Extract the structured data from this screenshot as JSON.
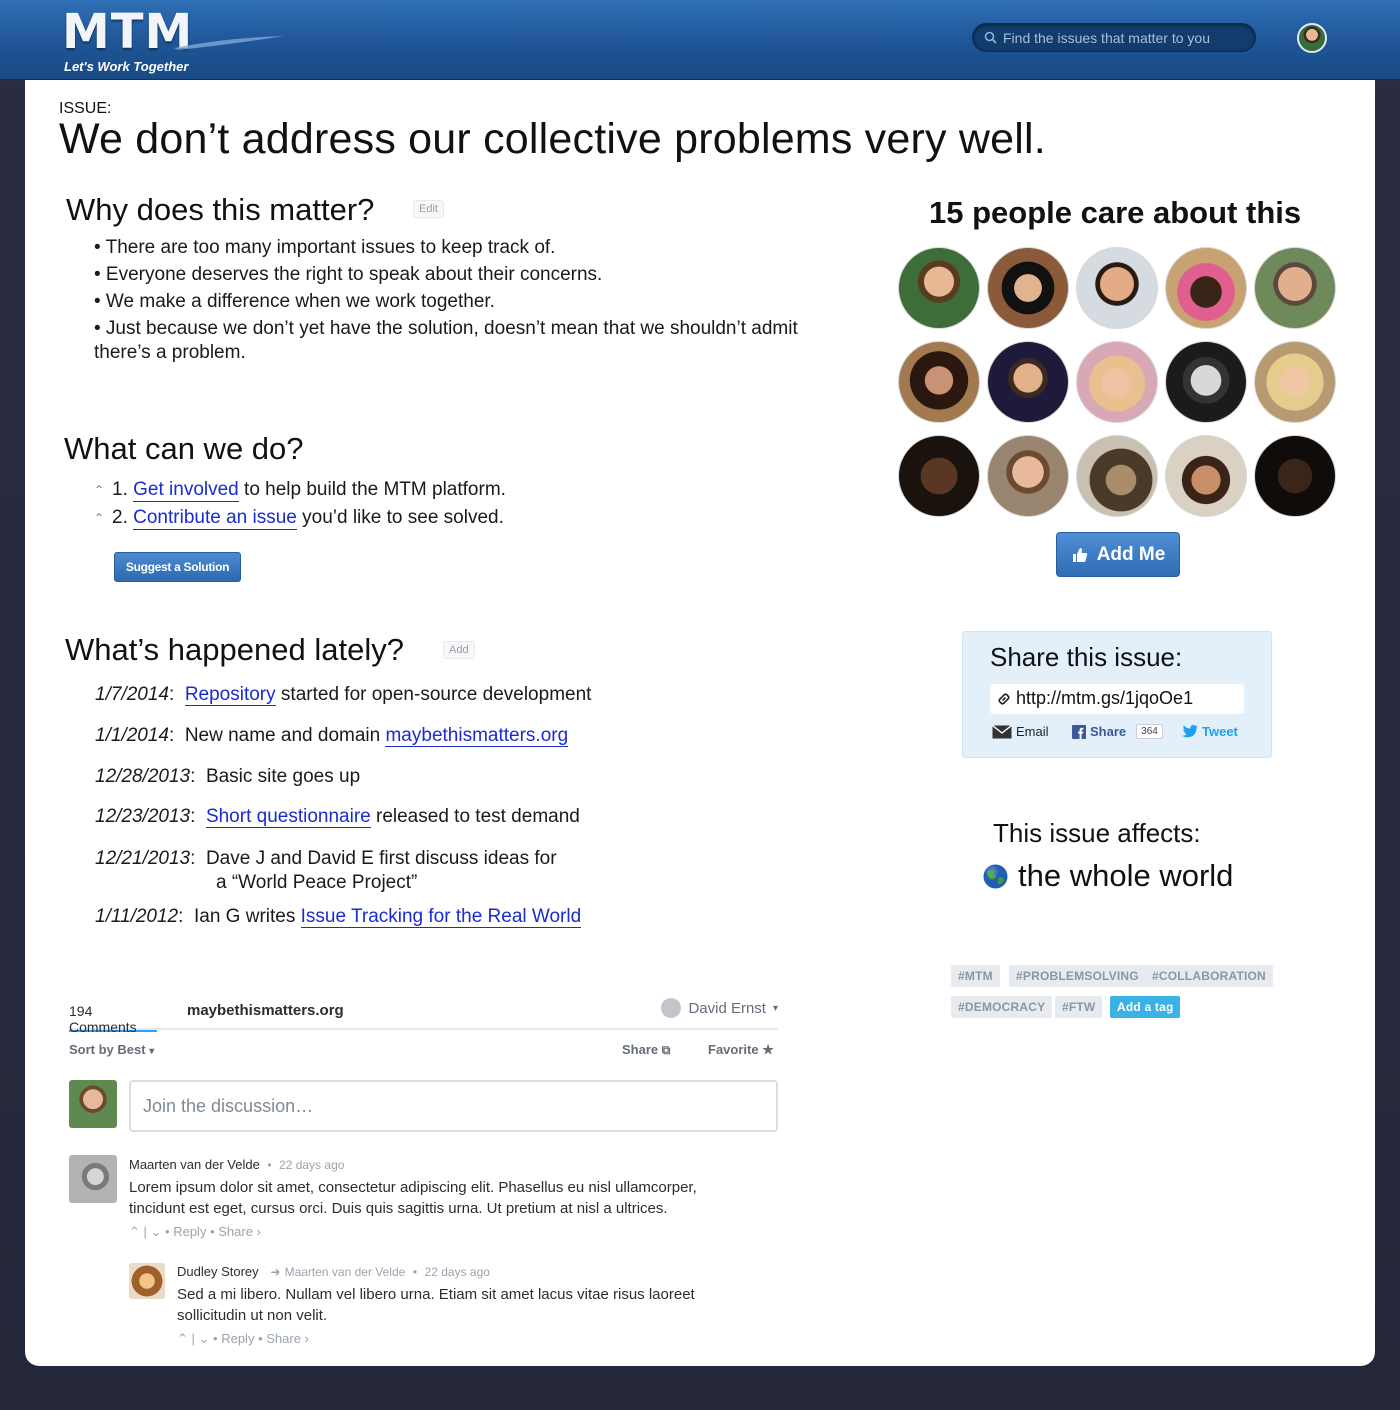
{
  "header": {
    "logo_text": "MTM",
    "tagline": "Let's Work Together",
    "search_placeholder": "Find the issues that matter to you"
  },
  "issue": {
    "label": "ISSUE:",
    "title": "We don’t address our collective problems very well."
  },
  "why": {
    "heading": "Why does this matter?",
    "edit_label": "Edit",
    "bullets": [
      "• There are too many important issues to keep track of.",
      "• Everyone deserves the right to speak about their concerns.",
      "• We make a difference when we work together.",
      "• Just because we don’t yet have the solution, doesn’t mean that we shouldn’t admit there’s a problem."
    ]
  },
  "what": {
    "heading": "What can we do?",
    "items": [
      {
        "num": "1.",
        "link": "Get involved",
        "rest": " to help build the MTM platform."
      },
      {
        "num": "2.",
        "link": "Contribute an issue",
        "rest": " you’d like to see solved."
      }
    ],
    "suggest_button": "Suggest a Solution"
  },
  "lately": {
    "heading": "What’s happened lately?",
    "add_label": "Add",
    "events": [
      {
        "date": "1/7/2014",
        "sep": ":",
        "pre": "",
        "link": "Repository",
        "post": " started for open-source development"
      },
      {
        "date": "1/1/2014",
        "sep": ":",
        "pre": "New name and domain ",
        "link": "maybethismatters.org",
        "post": ""
      },
      {
        "date": "12/28/2013",
        "sep": ":",
        "pre": "Basic site goes up",
        "link": "",
        "post": ""
      },
      {
        "date": "12/23/2013",
        "sep": ":",
        "pre": "",
        "link": "Short questionnaire",
        "post": " released to test demand"
      },
      {
        "date": "12/21/2013",
        "sep": ":",
        "pre": "Dave J and David E first discuss ideas for",
        "link": "",
        "post": "",
        "line2": "a “World Peace Project”"
      },
      {
        "date": "1/11/2012",
        "sep": ":",
        "pre": "Ian G writes ",
        "link": "Issue Tracking for the Real World",
        "post": ""
      }
    ]
  },
  "care": {
    "title": "15 people care about this",
    "add_me": "Add Me"
  },
  "share": {
    "heading": "Share this issue:",
    "url": "http://mtm.gs/1jqoOe1",
    "email": "Email",
    "fb_share": "Share",
    "fb_count": "364",
    "tweet": "Tweet"
  },
  "affects": {
    "heading": "This issue affects:",
    "value": "the whole world"
  },
  "tags": [
    "#MTM",
    "#PROBLEMSOLVING",
    "#COLLABORATION",
    "#DEMOCRACY",
    "#FTW"
  ],
  "add_tag": "Add a tag",
  "comments": {
    "count_tab": "194 Comments",
    "site_tab": "maybethismatters.org",
    "user": "David Ernst",
    "sort": "Sort by Best",
    "share": "Share",
    "favorite": "Favorite",
    "input_placeholder": "Join the discussion…",
    "list": [
      {
        "name": "Maarten van der Velde",
        "time": "22 days ago",
        "reply_to": "",
        "body": "Lorem ipsum dolor sit amet, consectetur adipiscing elit. Phasellus eu nisl ullamcorper, tincidunt est eget, cursus orci. Duis quis sagittis urna. Ut pretium at nisl a ultrices.",
        "reply": "Reply",
        "share": "Share ›"
      },
      {
        "name": "Dudley Storey",
        "time": "22 days ago",
        "reply_to": "Maarten van der Velde",
        "body": "Sed a mi libero. Nullam vel libero urna. Etiam sit amet lacus vitae risus laoreet sollicitudin ut non velit.",
        "reply": "Reply",
        "share": "Share ›"
      }
    ]
  }
}
